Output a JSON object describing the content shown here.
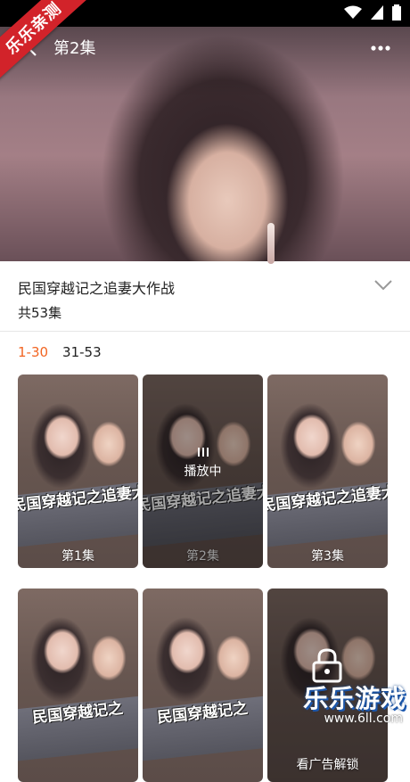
{
  "badge": {
    "text": "乐乐亲测"
  },
  "player": {
    "title": "第2集"
  },
  "drama": {
    "title": "民国穿越记之追妻大作战",
    "episode_count": "共53集"
  },
  "range_tabs": [
    {
      "label": "1-30",
      "active": true
    },
    {
      "label": "31-53",
      "active": false
    }
  ],
  "episodes": [
    {
      "label": "第1集",
      "state": "normal",
      "poster_text": "民国穿越记之追妻大作战"
    },
    {
      "label": "第2集",
      "state": "playing",
      "playing_text": "播放中",
      "poster_text": "民国穿越记之追妻大作战"
    },
    {
      "label": "第3集",
      "state": "normal",
      "poster_text": "民国穿越记之追妻大作战"
    },
    {
      "label": "",
      "state": "normal",
      "poster_text": "民国穿越记之"
    },
    {
      "label": "",
      "state": "normal",
      "poster_text": "民国穿越记之"
    },
    {
      "label": "看广告解锁",
      "state": "locked",
      "poster_text": ""
    }
  ],
  "watermark": {
    "title": "乐乐游戏",
    "url": "www.6ll.com"
  },
  "colors": {
    "accent": "#f26522",
    "badge": "#d2232a"
  }
}
